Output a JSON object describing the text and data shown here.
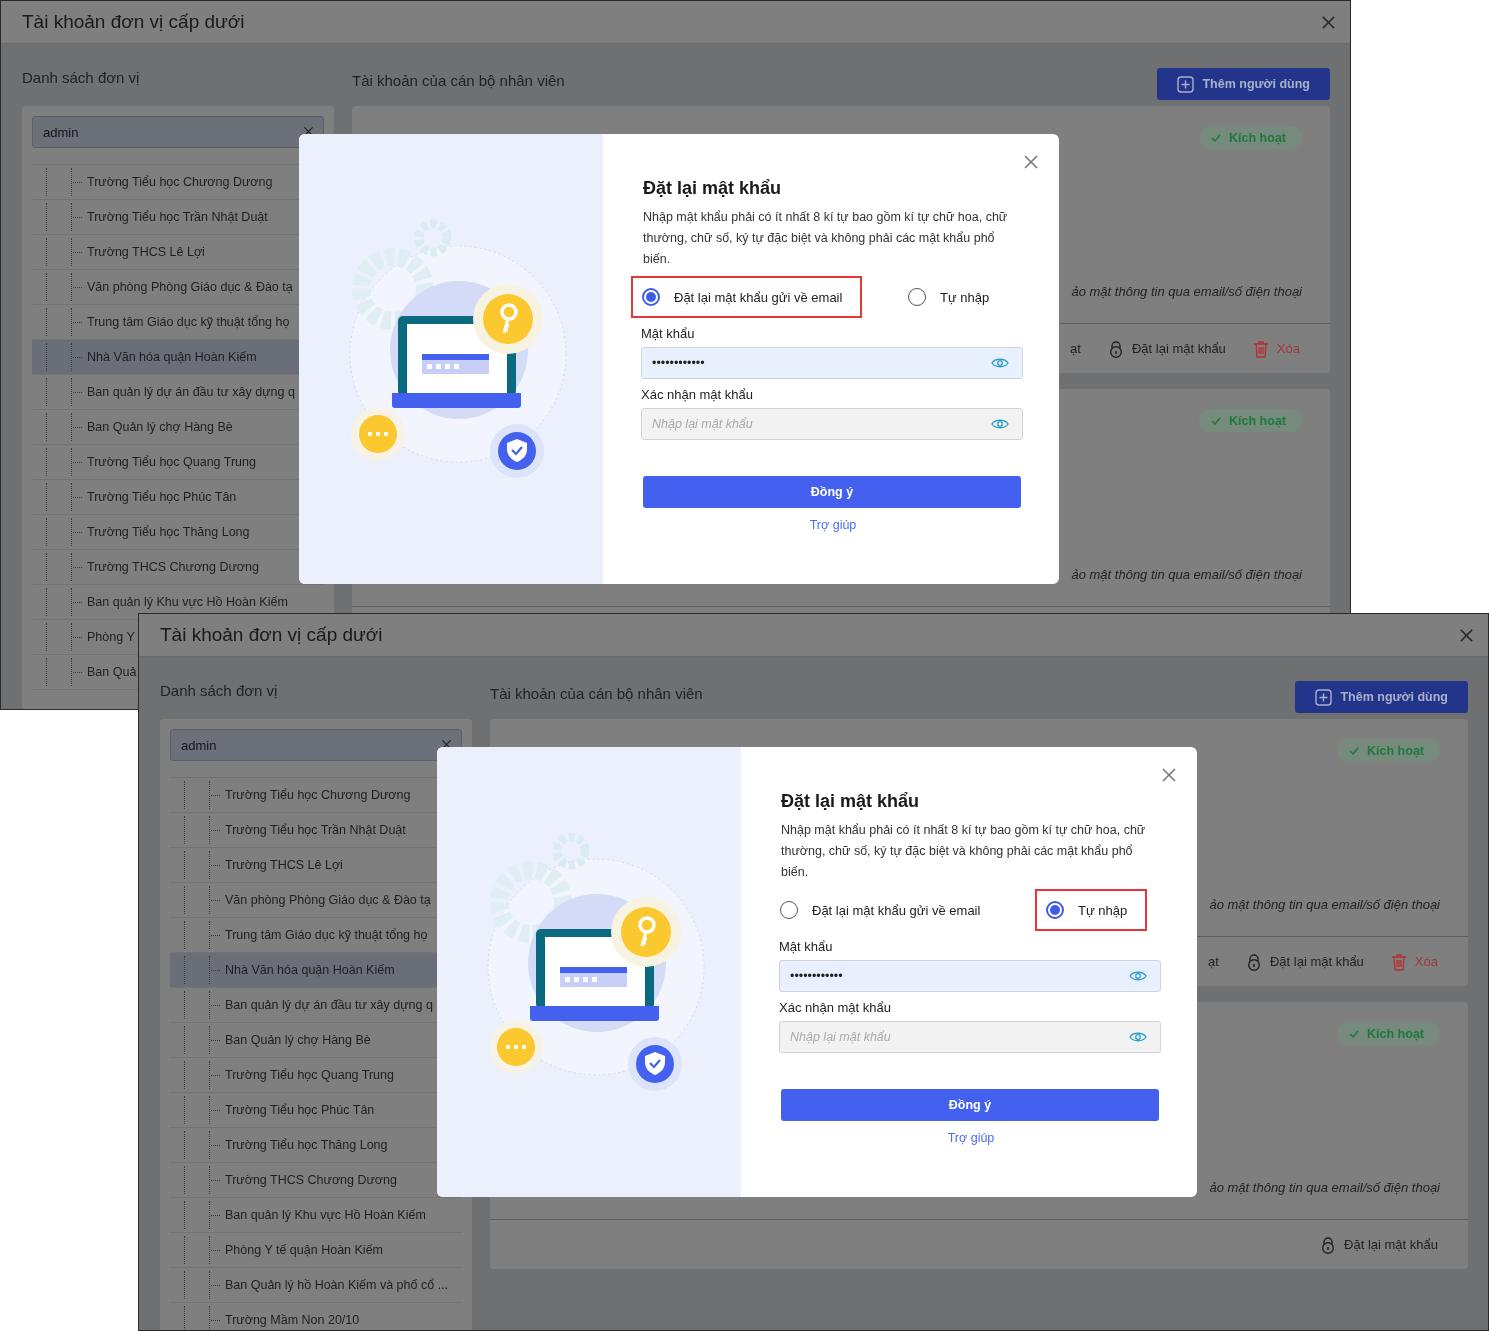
{
  "screens": [
    {
      "window": {
        "title": "Tài khoản đơn vị cấp dưới"
      },
      "units": {
        "heading": "Danh sách đơn vị",
        "search": {
          "value": "admin"
        },
        "items": [
          {
            "label": "Trường Tiểu học Chương Dương",
            "selected": false
          },
          {
            "label": "Trường Tiểu học Trần Nhật Duật",
            "selected": false
          },
          {
            "label": "Trường THCS Lê Lợi",
            "selected": false
          },
          {
            "label": "Văn phòng Phòng Giáo dục & Đào tạ",
            "selected": false
          },
          {
            "label": "Trung tâm Giáo dục kỹ thuật tổng họ",
            "selected": false
          },
          {
            "label": "Nhà Văn hóa quận Hoàn Kiếm",
            "selected": true
          },
          {
            "label": "Ban quản lý dự án đầu tư xây dựng q",
            "selected": false
          },
          {
            "label": "Ban Quản lý chợ Hàng Bè",
            "selected": false
          },
          {
            "label": "Trường Tiểu học Quang Trung",
            "selected": false
          },
          {
            "label": "Trường Tiểu học Phúc Tân",
            "selected": false
          },
          {
            "label": "Trường Tiểu học Thăng Long",
            "selected": false
          },
          {
            "label": "Trường THCS Chương Dương",
            "selected": false
          },
          {
            "label": "Ban quản lý Khu vực Hồ Hoàn Kiếm",
            "selected": false
          },
          {
            "label": "Phòng Y",
            "selected": false
          },
          {
            "label": "Ban Quả",
            "selected": false
          }
        ]
      },
      "accounts": {
        "heading": "Tài khoản của cán bộ nhân viên",
        "add_button": "Thêm người dùng",
        "cards": [
          {
            "status": "Kích hoạt",
            "note": "ảo mật thông tin qua email/số điện thoại",
            "actions": [
              {
                "kind": "plain",
                "label": "ạt"
              },
              {
                "kind": "lock",
                "label": "Đặt lại mật khẩu"
              },
              {
                "kind": "trash",
                "label": "Xóa"
              }
            ]
          },
          {
            "status": "Kích hoạt",
            "note": "ảo mật thông tin qua email/số điện thoại"
          }
        ]
      },
      "dialog": {
        "title": "Đặt lại mật khẩu",
        "description": "Nhập mật khẩu phải có ít nhất 8 kí tự bao gồm kí tự chữ hoa, chữ thường, chữ số, ký tự đặc biệt và không phải các mật khẩu phổ biến.",
        "options": [
          {
            "label": "Đặt lại mật khẩu gửi về email",
            "selected": true,
            "highlighted": true
          },
          {
            "label": "Tự nhập",
            "selected": false,
            "highlighted": false
          }
        ],
        "fields": [
          {
            "label": "Mật khẩu",
            "value": "••••••••••••"
          },
          {
            "label": "Xác nhận mật khẩu",
            "placeholder": "Nhập lại mật khẩu"
          }
        ],
        "submit": "Đồng ý",
        "help": "Trợ giúp"
      }
    },
    {
      "window": {
        "title": "Tài khoản đơn vị cấp dưới"
      },
      "units": {
        "heading": "Danh sách đơn vị",
        "search": {
          "value": "admin"
        },
        "items": [
          {
            "label": "Trường Tiểu học Chương Dương",
            "selected": false
          },
          {
            "label": "Trường Tiểu học Trần Nhật Duật",
            "selected": false
          },
          {
            "label": "Trường THCS Lê Lợi",
            "selected": false
          },
          {
            "label": "Văn phòng Phòng Giáo dục & Đào tạ",
            "selected": false
          },
          {
            "label": "Trung tâm Giáo dục kỹ thuật tổng họ",
            "selected": false
          },
          {
            "label": "Nhà Văn hóa quận Hoàn Kiếm",
            "selected": true
          },
          {
            "label": "Ban quản lý dự án đầu tư xây dựng q",
            "selected": false
          },
          {
            "label": "Ban Quản lý chợ Hàng Bè",
            "selected": false
          },
          {
            "label": "Trường Tiểu học Quang Trung",
            "selected": false
          },
          {
            "label": "Trường Tiểu học Phúc Tân",
            "selected": false
          },
          {
            "label": "Trường Tiểu học Thăng Long",
            "selected": false
          },
          {
            "label": "Trường THCS Chương Dương",
            "selected": false
          },
          {
            "label": "Ban quản lý Khu vực Hồ Hoàn Kiếm",
            "selected": false
          },
          {
            "label": "Phòng Y tế quận Hoàn Kiếm",
            "selected": false
          },
          {
            "label": "Ban Quản lý hồ Hoàn Kiếm và phố cổ ...",
            "selected": false
          },
          {
            "label": "Trường Mầm Non 20/10",
            "selected": false
          }
        ]
      },
      "accounts": {
        "heading": "Tài khoản của cán bộ nhân viên",
        "add_button": "Thêm người dùng",
        "cards": [
          {
            "status": "Kích hoạt",
            "note": "ảo mật thông tin qua email/số điện thoại",
            "actions": [
              {
                "kind": "plain",
                "label": "ạt"
              },
              {
                "kind": "lock",
                "label": "Đặt lại mật khẩu"
              },
              {
                "kind": "trash",
                "label": "Xóa"
              }
            ]
          },
          {
            "status": "Kích hoạt",
            "note": "ảo mật thông tin qua email/số điện thoại",
            "actions": [
              {
                "kind": "lock",
                "label": "Đặt lại mật khẩu"
              }
            ]
          }
        ]
      },
      "dialog": {
        "title": "Đặt lại mật khẩu",
        "description": "Nhập mật khẩu phải có ít nhất 8 kí tự bao gồm kí tự chữ hoa, chữ thường, chữ số, ký tự đặc biệt và không phải các mật khẩu phổ biến.",
        "options": [
          {
            "label": "Đặt lại mật khẩu gửi về email",
            "selected": false,
            "highlighted": false
          },
          {
            "label": "Tự nhập",
            "selected": true,
            "highlighted": true
          }
        ],
        "fields": [
          {
            "label": "Mật khẩu",
            "value": "••••••••••••"
          },
          {
            "label": "Xác nhận mật khẩu",
            "placeholder": "Nhập lại mật khẩu"
          }
        ],
        "submit": "Đồng ý",
        "help": "Trợ giúp"
      }
    }
  ]
}
